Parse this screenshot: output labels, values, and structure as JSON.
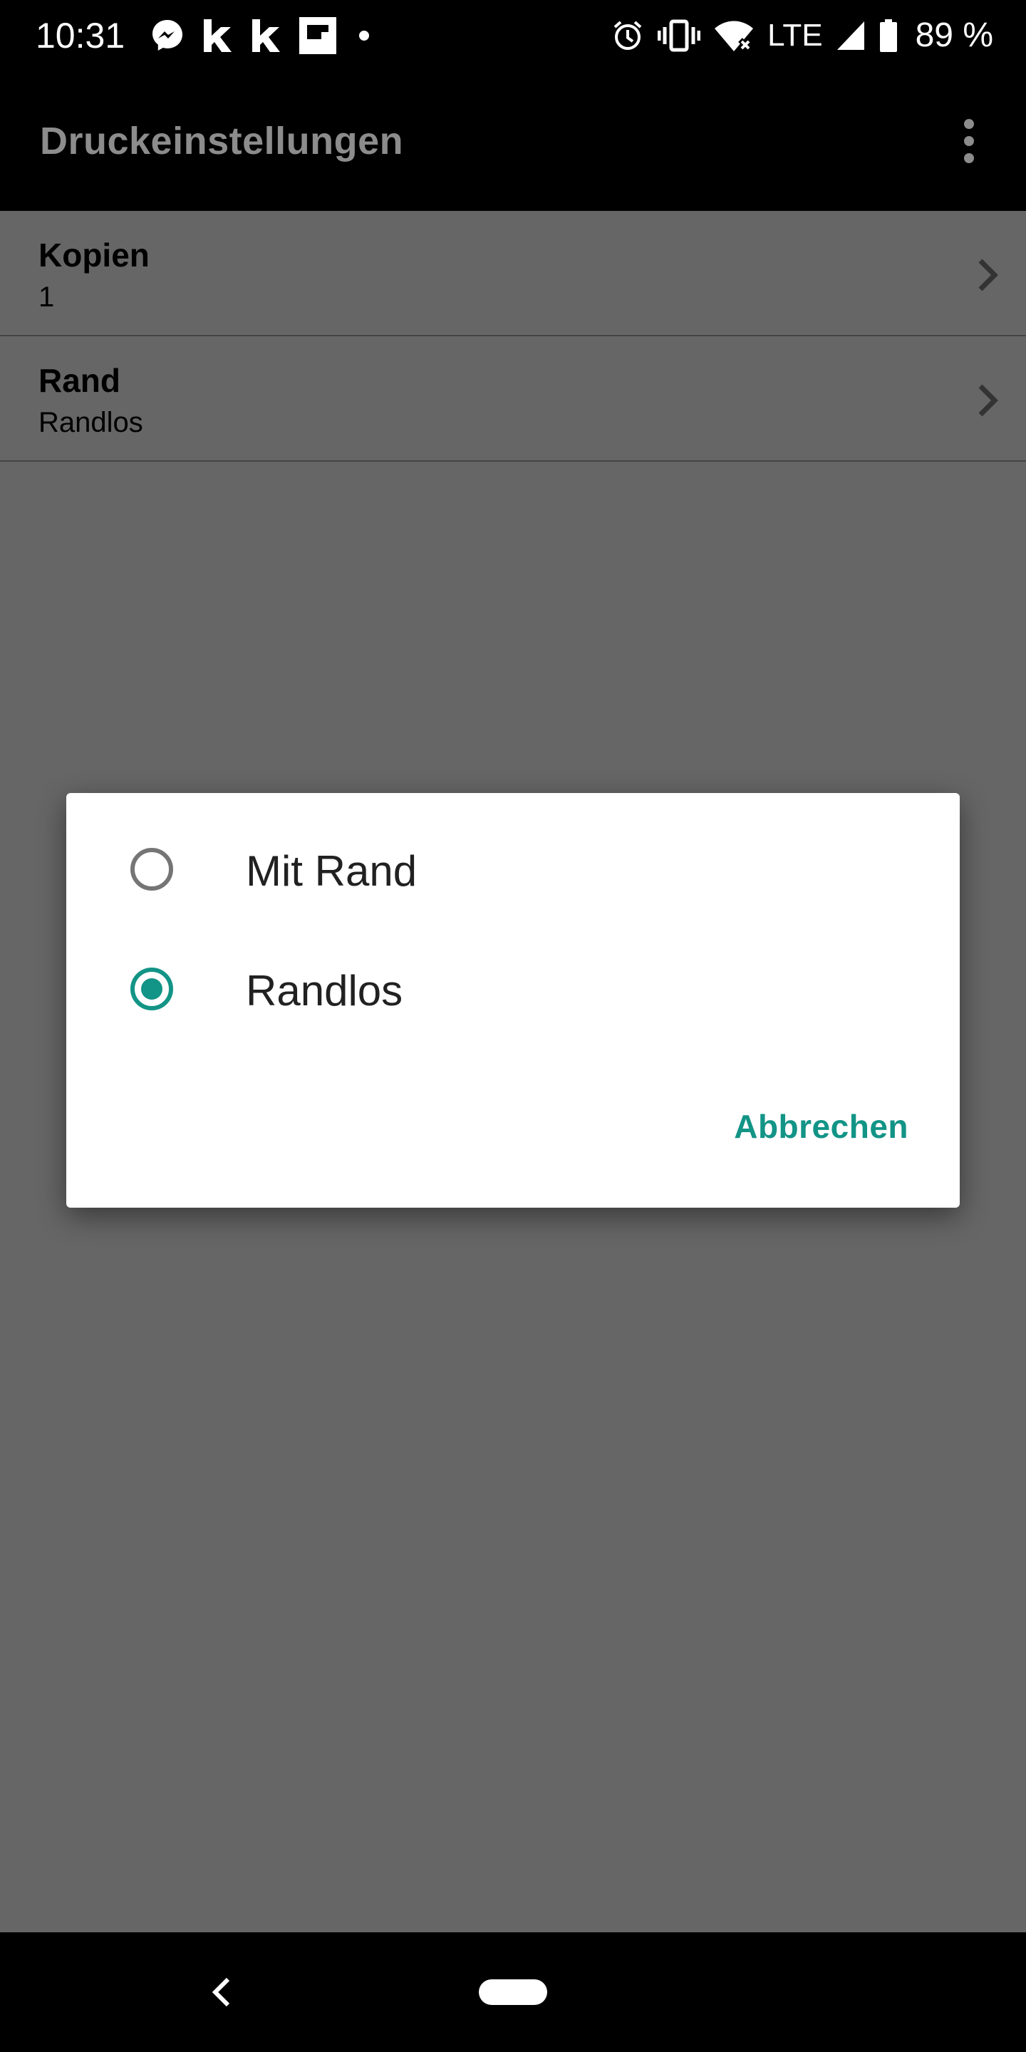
{
  "status_bar": {
    "time": "10:31",
    "left_icons": [
      "messenger-icon",
      "kicker-icon",
      "kicker-icon",
      "flipboard-icon",
      "dot-icon"
    ],
    "network": "LTE",
    "battery": "89 %"
  },
  "app_bar": {
    "title": "Druckeinstellungen",
    "overflow_icon": "more-vert-icon"
  },
  "settings": [
    {
      "title": "Kopien",
      "value": "1"
    },
    {
      "title": "Rand",
      "value": "Randlos"
    }
  ],
  "dialog": {
    "options": [
      {
        "label": "Mit Rand",
        "selected": false
      },
      {
        "label": "Randlos",
        "selected": true
      }
    ],
    "cancel_label": "Abbrechen"
  },
  "colors": {
    "accent": "#129486",
    "scrim_background": "#666666",
    "app_bar": "#000000"
  }
}
